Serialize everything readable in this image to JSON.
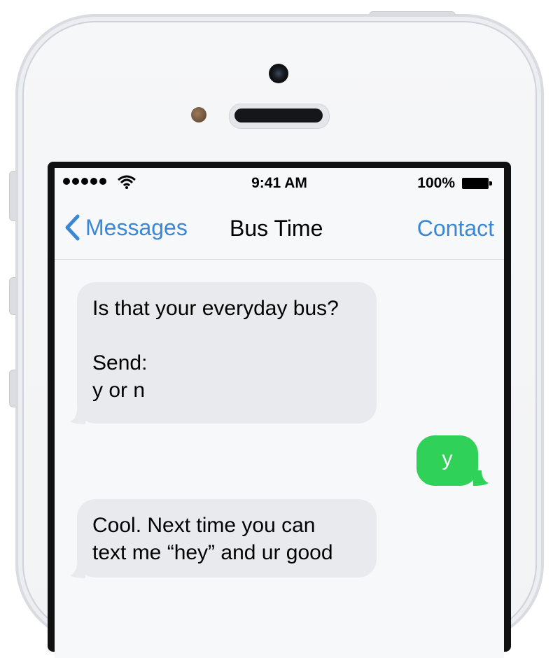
{
  "status_bar": {
    "time": "9:41 AM",
    "battery_percent": "100%",
    "signal_dots": 5
  },
  "nav": {
    "back_label": "Messages",
    "title": "Bus Time",
    "right_action": "Contact"
  },
  "messages": [
    {
      "direction": "incoming",
      "lines": [
        "Is that your everyday bus?",
        "",
        "Send:",
        "y or n"
      ]
    },
    {
      "direction": "outgoing",
      "text": "y"
    },
    {
      "direction": "incoming",
      "lines": [
        "Cool. Next time you can",
        "text me “hey” and ur good"
      ]
    }
  ],
  "colors": {
    "accent": "#3a87d6",
    "outgoing_bubble": "#2fd158",
    "incoming_bubble": "#e9eaed"
  }
}
